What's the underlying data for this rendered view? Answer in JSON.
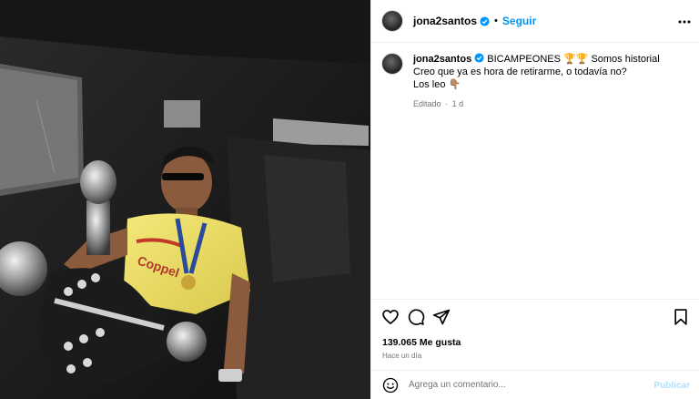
{
  "post": {
    "author": "jona2santos",
    "verified": true,
    "follow_label": "Seguir",
    "separator": "•",
    "more_icon": "more-horizontal-icon"
  },
  "caption": {
    "username": "jona2santos",
    "line1": "BICAMPEONES 🏆🏆 Somos historial",
    "line2": "Creo que ya es hora de retirarme, o todavía no?",
    "line3": "Los leo 👇🏽",
    "edited_label": "Editado",
    "dot": "·",
    "age": "1 d"
  },
  "actions": {
    "like_icon": "heart-icon",
    "comment_icon": "comment-icon",
    "share_icon": "share-icon",
    "save_icon": "bookmark-icon",
    "likes_text": "139.065 Me gusta",
    "time_text": "Hace un día"
  },
  "comment_box": {
    "emoji_icon": "smiley-icon",
    "placeholder": "Agrega un comentario...",
    "value": "",
    "publish_label": "Publicar"
  },
  "colors": {
    "accent": "#0095f6",
    "publish_disabled": "#b2dffc",
    "secondary_text": "#737373",
    "divider": "#efefef"
  }
}
